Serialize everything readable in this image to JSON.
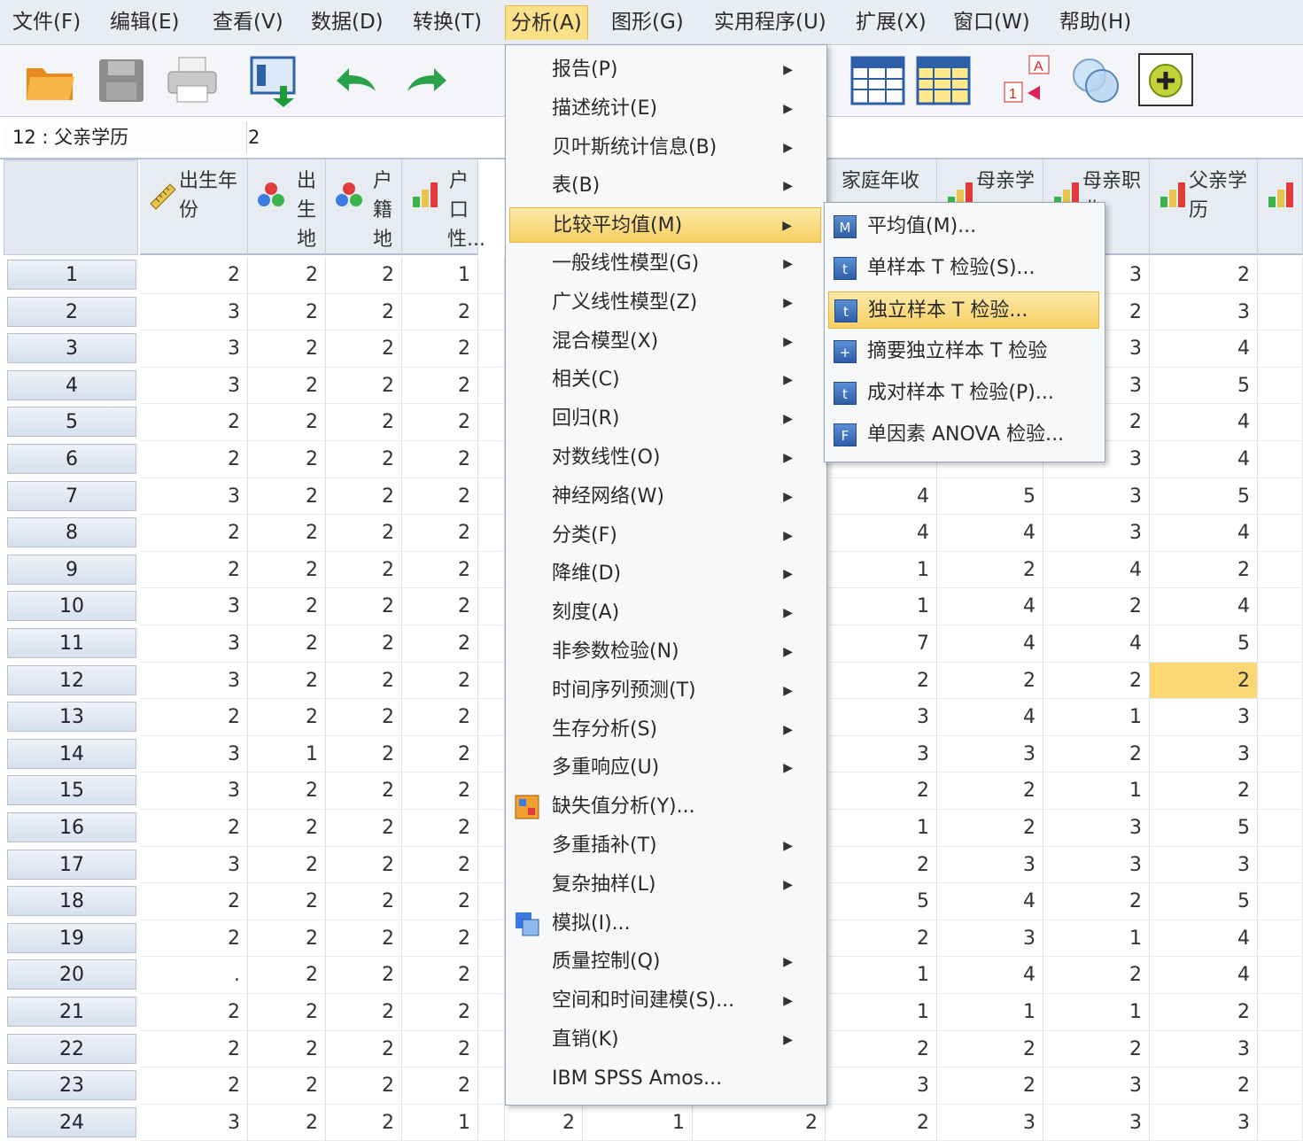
{
  "menubar": {
    "items": [
      "文件(F)",
      "编辑(E)",
      "查看(V)",
      "数据(D)",
      "转换(T)",
      "分析(A)",
      "图形(G)",
      "实用程序(U)",
      "扩展(X)",
      "窗口(W)",
      "帮助(H)"
    ],
    "active": "分析(A)"
  },
  "toolbar": {
    "buttons": [
      "open-icon",
      "save-icon",
      "print-icon",
      "dialog-recall-icon",
      "undo-icon",
      "redo-icon",
      "goto-case-icon",
      "split-file-icon",
      "select-cases-icon",
      "value-labels-icon",
      "use-sets-icon",
      "add-ons-icon"
    ]
  },
  "refbar": {
    "name": "12 : 父亲学历",
    "value": "2"
  },
  "columns_left": [
    {
      "label": "出生年份",
      "icon": "ruler-icon"
    },
    {
      "label": "出生地",
      "icon": "nominal-icon"
    },
    {
      "label": "户籍地",
      "icon": "nominal-icon"
    },
    {
      "label": "户口性...",
      "icon": "ordinal-icon"
    }
  ],
  "columns_right": [
    {
      "label": "家庭年收",
      "icon": "ordinal-icon"
    },
    {
      "label": "母亲学",
      "icon": "ordinal-icon"
    },
    {
      "label": "母亲职业",
      "icon": "ordinal-icon"
    },
    {
      "label": "父亲学历",
      "icon": "ordinal-icon"
    }
  ],
  "rows": [
    {
      "n": "1",
      "left": [
        "2",
        "2",
        "2",
        "1"
      ],
      "right": [
        "",
        "",
        "3",
        "2"
      ]
    },
    {
      "n": "2",
      "left": [
        "3",
        "2",
        "2",
        "2"
      ],
      "right": [
        "",
        "",
        "2",
        "3"
      ]
    },
    {
      "n": "3",
      "left": [
        "3",
        "2",
        "2",
        "2"
      ],
      "right": [
        "",
        "",
        "3",
        "4"
      ]
    },
    {
      "n": "4",
      "left": [
        "3",
        "2",
        "2",
        "2"
      ],
      "right": [
        "",
        "",
        "3",
        "5"
      ]
    },
    {
      "n": "5",
      "left": [
        "2",
        "2",
        "2",
        "2"
      ],
      "right": [
        "",
        "",
        "2",
        "4"
      ]
    },
    {
      "n": "6",
      "left": [
        "2",
        "2",
        "2",
        "2"
      ],
      "right": [
        "",
        "",
        "3",
        "4"
      ]
    },
    {
      "n": "7",
      "left": [
        "3",
        "2",
        "2",
        "2"
      ],
      "right": [
        "4",
        "5",
        "3",
        "5"
      ]
    },
    {
      "n": "8",
      "left": [
        "2",
        "2",
        "2",
        "2"
      ],
      "right": [
        "4",
        "4",
        "3",
        "4"
      ]
    },
    {
      "n": "9",
      "left": [
        "2",
        "2",
        "2",
        "2"
      ],
      "right": [
        "1",
        "2",
        "4",
        "2"
      ]
    },
    {
      "n": "10",
      "left": [
        "3",
        "2",
        "2",
        "2"
      ],
      "right": [
        "1",
        "4",
        "2",
        "4"
      ]
    },
    {
      "n": "11",
      "left": [
        "3",
        "2",
        "2",
        "2"
      ],
      "right": [
        "7",
        "4",
        "4",
        "5"
      ]
    },
    {
      "n": "12",
      "left": [
        "3",
        "2",
        "2",
        "2"
      ],
      "right": [
        "2",
        "2",
        "2",
        "2"
      ]
    },
    {
      "n": "13",
      "left": [
        "2",
        "2",
        "2",
        "2"
      ],
      "right": [
        "3",
        "4",
        "1",
        "3"
      ]
    },
    {
      "n": "14",
      "left": [
        "3",
        "1",
        "2",
        "2"
      ],
      "right": [
        "3",
        "3",
        "2",
        "3"
      ]
    },
    {
      "n": "15",
      "left": [
        "3",
        "2",
        "2",
        "2"
      ],
      "right": [
        "2",
        "2",
        "1",
        "2"
      ]
    },
    {
      "n": "16",
      "left": [
        "2",
        "2",
        "2",
        "2"
      ],
      "right": [
        "1",
        "2",
        "3",
        "5"
      ]
    },
    {
      "n": "17",
      "left": [
        "3",
        "2",
        "2",
        "2"
      ],
      "right": [
        "2",
        "3",
        "3",
        "3"
      ]
    },
    {
      "n": "18",
      "left": [
        "2",
        "2",
        "2",
        "2"
      ],
      "right": [
        "5",
        "4",
        "2",
        "5"
      ]
    },
    {
      "n": "19",
      "left": [
        "2",
        "2",
        "2",
        "2"
      ],
      "right": [
        "2",
        "3",
        "1",
        "4"
      ]
    },
    {
      "n": "20",
      "left": [
        ".",
        "2",
        "2",
        "2"
      ],
      "right": [
        "1",
        "4",
        "2",
        "4"
      ]
    },
    {
      "n": "21",
      "left": [
        "2",
        "2",
        "2",
        "2"
      ],
      "right": [
        "1",
        "1",
        "1",
        "2"
      ]
    },
    {
      "n": "22",
      "left": [
        "2",
        "2",
        "2",
        "2"
      ],
      "right": [
        "2",
        "2",
        "2",
        "3"
      ]
    },
    {
      "n": "23",
      "left": [
        "2",
        "2",
        "2",
        "2"
      ],
      "right": [
        "3",
        "2",
        "3",
        "2"
      ]
    },
    {
      "n": "24",
      "left": [
        "3",
        "2",
        "2",
        "1"
      ],
      "right": [
        "2",
        "3",
        "3",
        "3"
      ]
    }
  ],
  "row24_hidden_cells": [
    "2",
    "1",
    "2"
  ],
  "analyze_menu": {
    "items": [
      {
        "label": "报告(P)",
        "arrow": true
      },
      {
        "label": "描述统计(E)",
        "arrow": true
      },
      {
        "label": "贝叶斯统计信息(B)",
        "arrow": true
      },
      {
        "label": "表(B)",
        "arrow": true
      },
      {
        "label": "比较平均值(M)",
        "arrow": true,
        "highlight": true
      },
      {
        "label": "一般线性模型(G)",
        "arrow": true
      },
      {
        "label": "广义线性模型(Z)",
        "arrow": true
      },
      {
        "label": "混合模型(X)",
        "arrow": true
      },
      {
        "label": "相关(C)",
        "arrow": true
      },
      {
        "label": "回归(R)",
        "arrow": true
      },
      {
        "label": "对数线性(O)",
        "arrow": true
      },
      {
        "label": "神经网络(W)",
        "arrow": true
      },
      {
        "label": "分类(F)",
        "arrow": true
      },
      {
        "label": "降维(D)",
        "arrow": true
      },
      {
        "label": "刻度(A)",
        "arrow": true
      },
      {
        "label": "非参数检验(N)",
        "arrow": true
      },
      {
        "label": "时间序列预测(T)",
        "arrow": true
      },
      {
        "label": "生存分析(S)",
        "arrow": true
      },
      {
        "label": "多重响应(U)",
        "arrow": true
      },
      {
        "label": "缺失值分析(Y)...",
        "arrow": false,
        "icon": "missing-value-icon"
      },
      {
        "label": "多重插补(T)",
        "arrow": true
      },
      {
        "label": "复杂抽样(L)",
        "arrow": true
      },
      {
        "label": "模拟(I)...",
        "arrow": false,
        "icon": "simulation-icon"
      },
      {
        "label": "质量控制(Q)",
        "arrow": true
      },
      {
        "label": "空间和时间建模(S)...",
        "arrow": true
      },
      {
        "label": "直销(K)",
        "arrow": true
      },
      {
        "label": "IBM SPSS Amos...",
        "arrow": false
      }
    ]
  },
  "submenu": {
    "items": [
      {
        "label": "平均值(M)...",
        "glyph": "M"
      },
      {
        "label": "单样本 T 检验(S)...",
        "glyph": "t"
      },
      {
        "label": "独立样本 T 检验...",
        "glyph": "t",
        "highlight": true
      },
      {
        "label": "摘要独立样本 T 检验",
        "glyph": "+"
      },
      {
        "label": "成对样本 T 检验(P)...",
        "glyph": "t"
      },
      {
        "label": "单因素 ANOVA 检验...",
        "glyph": "F"
      }
    ]
  },
  "colors": {
    "highlight": "#f8cf63",
    "selected_cell": "#fbd874",
    "header_bg": "#e7ecf3",
    "menubar_bg": "#e9edf3"
  }
}
